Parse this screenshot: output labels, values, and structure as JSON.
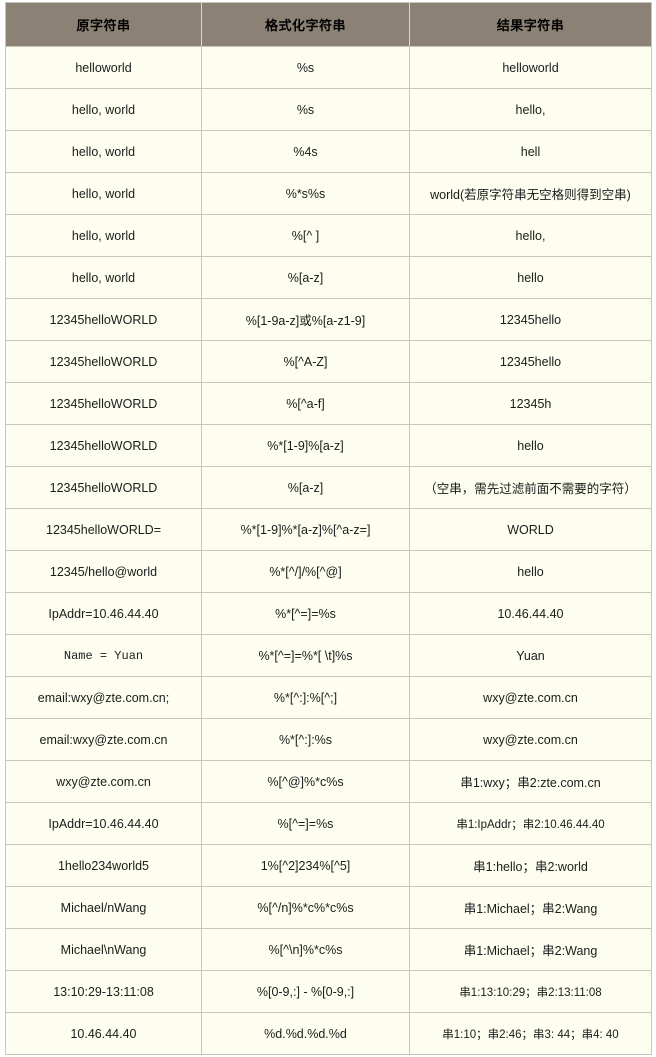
{
  "table": {
    "headers": [
      "原字符串",
      "格式化字符串",
      "结果字符串"
    ],
    "rows": [
      {
        "source": "helloworld",
        "format": "%s",
        "result": "helloworld"
      },
      {
        "source": "hello, world",
        "format": "%s",
        "result": "hello,"
      },
      {
        "source": "hello, world",
        "format": "%4s",
        "result": "hell"
      },
      {
        "source": "hello, world",
        "format": "%*s%s",
        "result": "world(若原字符串无空格则得到空串)"
      },
      {
        "source": "hello, world",
        "format": "%[^ ]",
        "result": "hello,"
      },
      {
        "source": "hello, world",
        "format": "%[a-z]",
        "result": "hello"
      },
      {
        "source": "12345helloWORLD",
        "format": "%[1-9a-z]或%[a-z1-9]",
        "result": "12345hello"
      },
      {
        "source": "12345helloWORLD",
        "format": "%[^A-Z]",
        "result": "12345hello"
      },
      {
        "source": "12345helloWORLD",
        "format": "%[^a-f]",
        "result": "12345h"
      },
      {
        "source": "12345helloWORLD",
        "format": "%*[1-9]%[a-z]",
        "result": "hello"
      },
      {
        "source": "12345helloWORLD",
        "format": "%[a-z]",
        "result": "（空串，需先过滤前面不需要的字符）"
      },
      {
        "source": "12345helloWORLD=",
        "format": "%*[1-9]%*[a-z]%[^a-z=]",
        "result": "WORLD"
      },
      {
        "source": "12345/hello@world",
        "format": "%*[^/]/%[^@]",
        "result": "hello"
      },
      {
        "source": "IpAddr=10.46.44.40",
        "format": "%*[^=]=%s",
        "result": "10.46.44.40"
      },
      {
        "source": "Name  =  Yuan",
        "format": "%*[^=]=%*[ \\t]%s",
        "result": "Yuan",
        "source_mono": true
      },
      {
        "source": "email:wxy@zte.com.cn;",
        "format": "%*[^:]:%[^;]",
        "result": "wxy@zte.com.cn"
      },
      {
        "source": "email:wxy@zte.com.cn",
        "format": "%*[^:]:%s",
        "result": "wxy@zte.com.cn"
      },
      {
        "source": "wxy@zte.com.cn",
        "format": "%[^@]%*c%s",
        "result": "串1:wxy；串2:zte.com.cn"
      },
      {
        "source": "IpAddr=10.46.44.40",
        "format": "%[^=]=%s",
        "result": "串1:IpAddr；串2:10.46.44.40"
      },
      {
        "source": "1hello234world5",
        "format": "1%[^2]234%[^5]",
        "result": "串1:hello；串2:world"
      },
      {
        "source": "Michael/nWang",
        "format": "%[^/n]%*c%*c%s",
        "result": "串1:Michael；串2:Wang"
      },
      {
        "source": "Michael\\nWang",
        "format": "%[^\\n]%*c%s",
        "result": "串1:Michael；串2:Wang"
      },
      {
        "source": "13:10:29-13:11:08",
        "format": "%[0-9,:] - %[0-9,:]",
        "result": "串1:13:10:29；串2:13:11:08"
      },
      {
        "source": "10.46.44.40",
        "format": "%d.%d.%d.%d",
        "result": "串1:10；串2:46；串3: 44；串4: 40"
      }
    ]
  },
  "colors": {
    "header_bg": "#8b8174",
    "cell_bg": "#fdfdf0",
    "border": "#c6c6ba",
    "text": "#1c1c1c"
  }
}
